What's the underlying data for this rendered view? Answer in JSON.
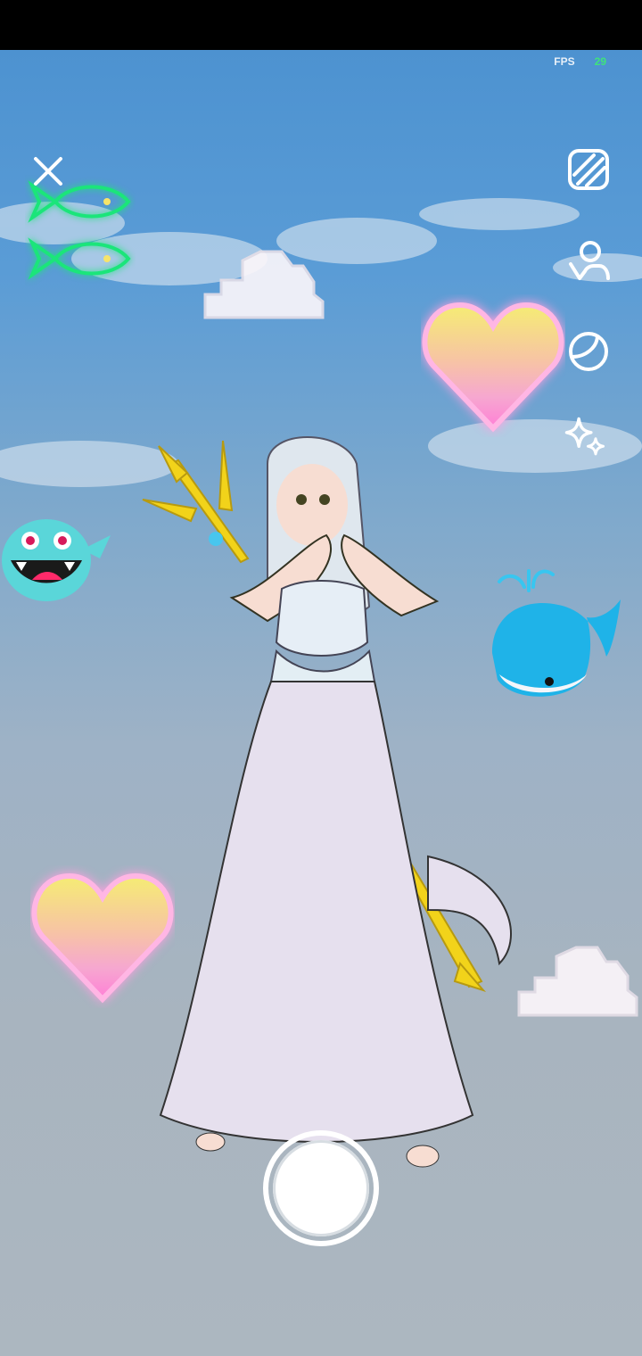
{
  "status_bar": {},
  "fps": {
    "label": "FPS",
    "value": "29"
  },
  "toolbar": {
    "icons": [
      "aspect-ratio-icon",
      "avatar-pose-icon",
      "filter-icon",
      "sparkle-effects-icon"
    ]
  },
  "colors": {
    "neon_fish": "#1be57a",
    "heart_top": "#f5ec74",
    "heart_bottom": "#ff7fd6",
    "whale": "#1fb3e8",
    "monster": "#5ad6d9",
    "trident": "#f2d31a"
  }
}
